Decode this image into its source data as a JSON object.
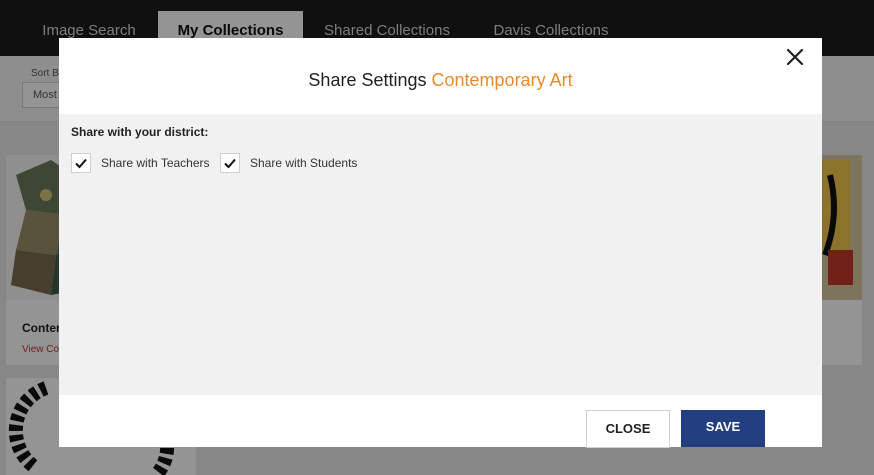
{
  "nav": {
    "tabs": [
      {
        "label": "Image Search"
      },
      {
        "label": "My Collections"
      },
      {
        "label": "Shared Collections"
      },
      {
        "label": "Davis Collections"
      }
    ]
  },
  "filters": {
    "sort_label": "Sort B",
    "sort_value": "Most"
  },
  "cards": {
    "left_title": "Conter",
    "left_link": "View Co"
  },
  "modal": {
    "title_prefix": "Share Settings",
    "collection_name": "Contemporary Art",
    "section_label": "Share with your district:",
    "options": [
      {
        "label": "Share with Teachers",
        "checked": true
      },
      {
        "label": "Share with Students",
        "checked": true
      }
    ],
    "close_label": "CLOSE",
    "save_label": "SAVE"
  },
  "colors": {
    "accent": "#e98a2b",
    "primary_button": "#233f82",
    "nav_background": "#1c1c1c"
  },
  "icons": [
    "close-icon",
    "checkmark-icon"
  ]
}
